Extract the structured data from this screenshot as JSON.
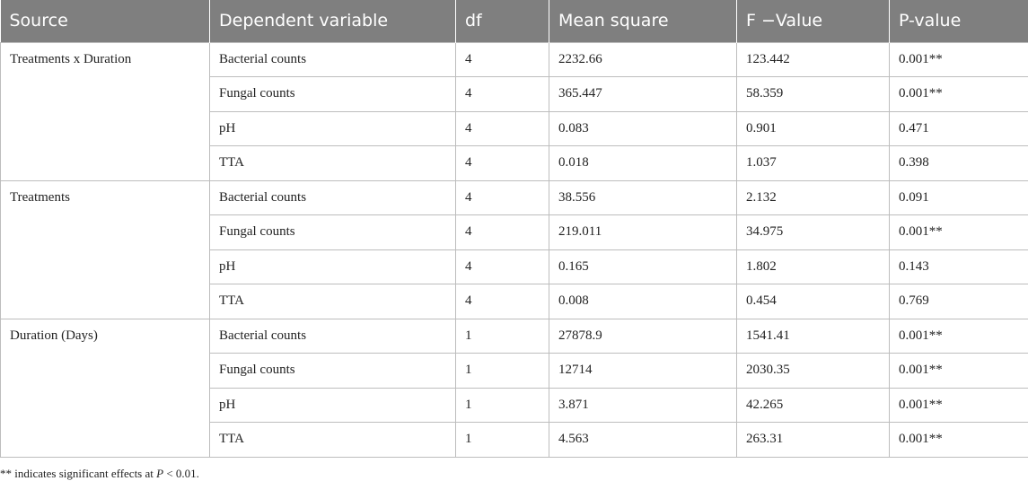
{
  "table": {
    "headers": [
      "Source",
      "Dependent variable",
      "df",
      "Mean square",
      "F −Value",
      "P-value"
    ],
    "groups": [
      {
        "source": "Treatments x Duration",
        "rows": [
          [
            "Bacterial counts",
            "4",
            "2232.66",
            "123.442",
            "0.001**"
          ],
          [
            "Fungal counts",
            "4",
            "365.447",
            "58.359",
            "0.001**"
          ],
          [
            "pH",
            "4",
            "0.083",
            "0.901",
            "0.471"
          ],
          [
            "TTA",
            "4",
            "0.018",
            "1.037",
            "0.398"
          ]
        ]
      },
      {
        "source": "Treatments",
        "rows": [
          [
            "Bacterial counts",
            "4",
            "38.556",
            "2.132",
            "0.091"
          ],
          [
            "Fungal counts",
            "4",
            "219.011",
            "34.975",
            "0.001**"
          ],
          [
            "pH",
            "4",
            "0.165",
            "1.802",
            "0.143"
          ],
          [
            "TTA",
            "4",
            "0.008",
            "0.454",
            "0.769"
          ]
        ]
      },
      {
        "source": "Duration (Days)",
        "rows": [
          [
            "Bacterial counts",
            "1",
            "27878.9",
            "1541.41",
            "0.001**"
          ],
          [
            "Fungal counts",
            "1",
            "12714",
            "2030.35",
            "0.001**"
          ],
          [
            "pH",
            "1",
            "3.871",
            "42.265",
            "0.001**"
          ],
          [
            "TTA",
            "1",
            "4.563",
            "263.31",
            "0.001**"
          ]
        ]
      }
    ]
  },
  "footnote": {
    "prefix": "** indicates significant effects at ",
    "italic": "P",
    "suffix": " < 0.01."
  }
}
